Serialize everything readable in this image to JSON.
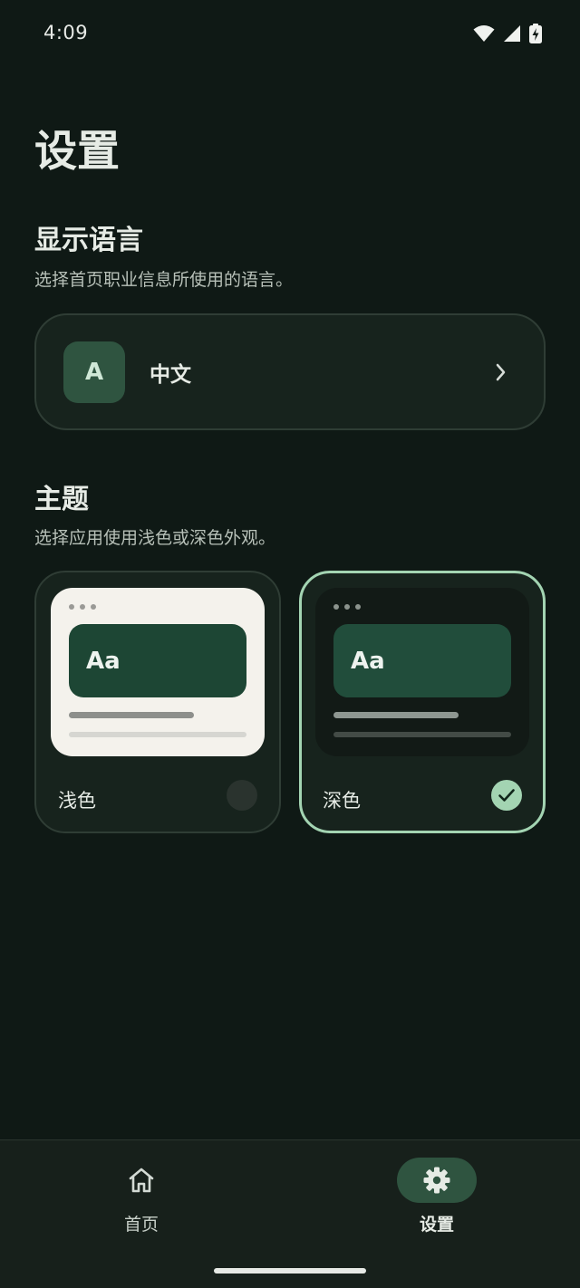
{
  "status_bar": {
    "time": "4:09"
  },
  "page": {
    "title": "设置"
  },
  "language_section": {
    "title": "显示语言",
    "description": "选择首页职业信息所使用的语言。",
    "avatar_letter": "A",
    "current_language": "中文"
  },
  "theme_section": {
    "title": "主题",
    "description": "选择应用使用浅色或深色外观。",
    "options": [
      {
        "label": "浅色",
        "preview_text": "Aa",
        "selected": false
      },
      {
        "label": "深色",
        "preview_text": "Aa",
        "selected": true
      }
    ]
  },
  "bottom_nav": {
    "items": [
      {
        "label": "首页",
        "icon": "home-icon",
        "active": false
      },
      {
        "label": "设置",
        "icon": "gear-icon",
        "active": true
      }
    ]
  },
  "colors": {
    "background": "#0f1915",
    "card": "#17231d",
    "accent": "#a3d4b2",
    "accent_container": "#2f5440"
  }
}
